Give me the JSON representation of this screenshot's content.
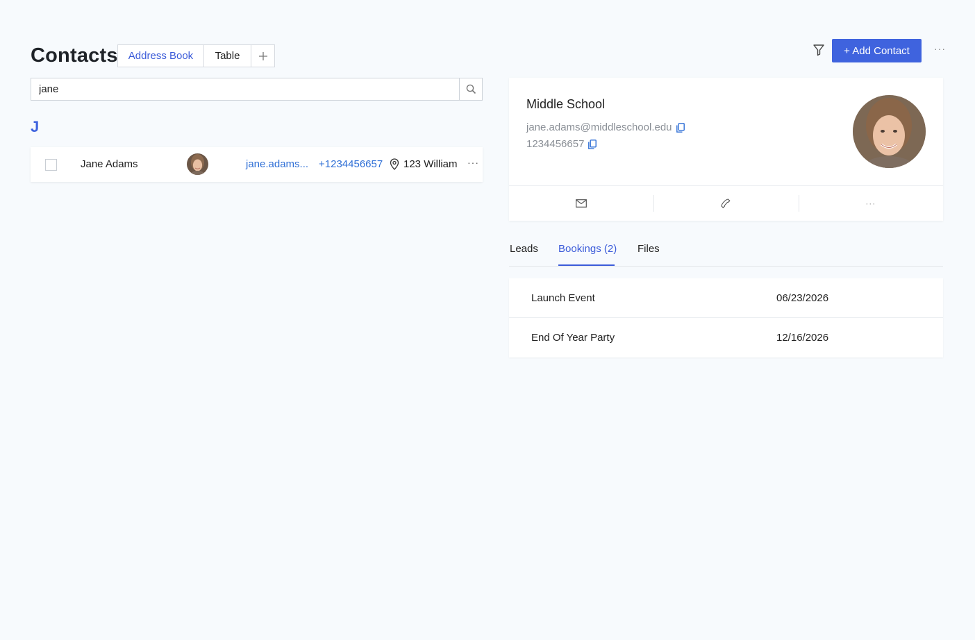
{
  "header": {
    "title": "Contacts",
    "view_tabs": [
      {
        "label": "Address Book",
        "active": true
      },
      {
        "label": "Table",
        "active": false
      }
    ],
    "add_view_label": "+",
    "add_contact_label": "+ Add Contact",
    "more_label": "···"
  },
  "search": {
    "value": "jane",
    "placeholder": ""
  },
  "list": {
    "group_letter": "J",
    "contacts": [
      {
        "name": "Jane Adams",
        "email": "jane.adams...",
        "phone": "+1234456657",
        "address": "123 William",
        "more": "···"
      }
    ]
  },
  "detail": {
    "organization": "Middle School",
    "email": "jane.adams@middleschool.edu",
    "phone": "1234456657",
    "actions_more": "···"
  },
  "detail_tabs": [
    {
      "label": "Leads",
      "active": false
    },
    {
      "label": "Bookings (2)",
      "active": true
    },
    {
      "label": "Files",
      "active": false
    }
  ],
  "bookings": [
    {
      "name": "Launch Event",
      "date": "06/23/2026"
    },
    {
      "name": "End Of Year Party",
      "date": "12/16/2026"
    }
  ],
  "colors": {
    "accent": "#3f63de",
    "link": "#2f6fd6",
    "background": "#f7fafd"
  },
  "icons": [
    "filter-icon",
    "search-icon",
    "location-pin-icon",
    "copy-icon",
    "mail-icon",
    "phone-icon",
    "more-icon"
  ]
}
